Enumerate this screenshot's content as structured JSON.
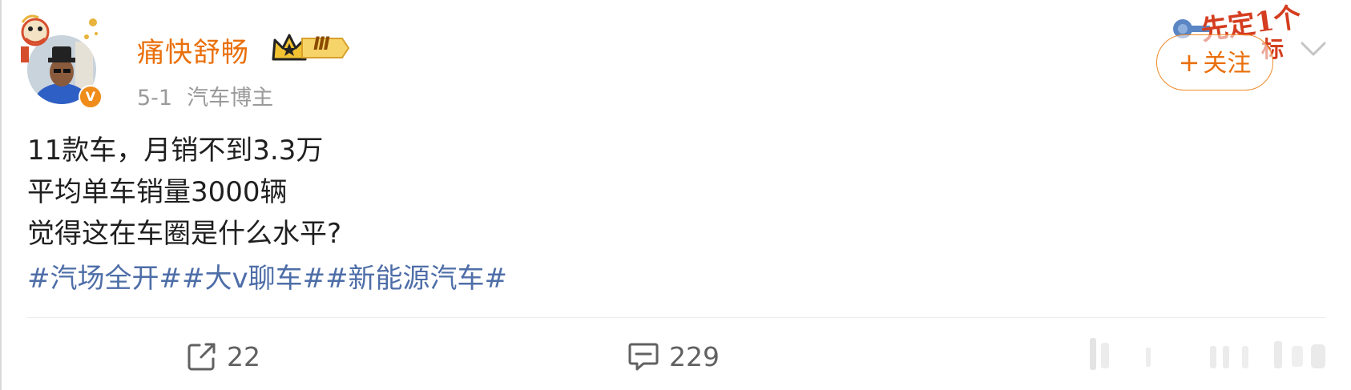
{
  "post": {
    "author": {
      "name": "痛快舒畅",
      "vip_level": "Ⅲ",
      "verified_mark": "V"
    },
    "meta": {
      "date": "5-1",
      "tag": "汽车博主"
    },
    "follow_button": {
      "plus": "+",
      "label": "关注"
    },
    "campaign_banner": {
      "text_line1": "先定1个",
      "text_line2": "标"
    },
    "body_lines": [
      "11款车，月销不到3.3万",
      "平均单车销量3000辆",
      "觉得这在车圈是什么水平?"
    ],
    "hashtags": "#汽场全开##大v聊车##新能源汽车#",
    "actions": {
      "share_count": "22",
      "comment_count": "229"
    }
  },
  "colors": {
    "username": "#ea6f0b",
    "hashtag": "#4e6ea8",
    "meta": "#9a9a9a",
    "follow_border": "#ee8a2a",
    "verified_badge": "#f08c1a"
  }
}
